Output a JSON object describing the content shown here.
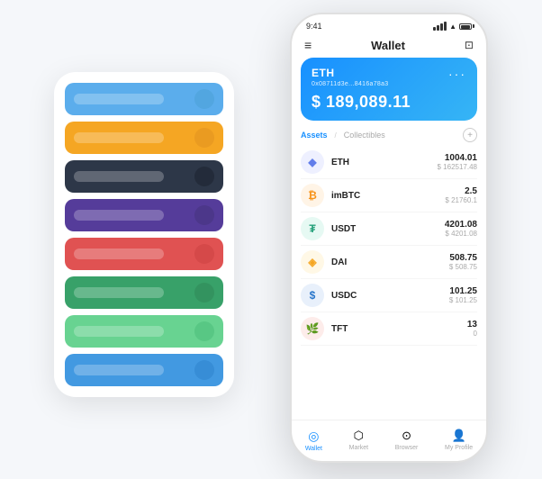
{
  "leftCards": [
    {
      "color": "#5badec",
      "dotColor": "#4a9fd4",
      "id": "blue-light"
    },
    {
      "color": "#f5a623",
      "dotColor": "#e09020",
      "id": "orange"
    },
    {
      "color": "#2d3748",
      "dotColor": "#1a202c",
      "id": "dark"
    },
    {
      "color": "#553c9a",
      "dotColor": "#44317a",
      "id": "purple"
    },
    {
      "color": "#e05252",
      "dotColor": "#c94040",
      "id": "red"
    },
    {
      "color": "#38a169",
      "dotColor": "#2e8655",
      "id": "green"
    },
    {
      "color": "#68d391",
      "dotColor": "#48bb78",
      "id": "green-light"
    },
    {
      "color": "#4299e1",
      "dotColor": "#2b82cb",
      "id": "blue"
    }
  ],
  "statusBar": {
    "time": "9:41"
  },
  "navBar": {
    "title": "Wallet"
  },
  "ethCard": {
    "label": "ETH",
    "address": "0x08711d3e...8416a78a3",
    "balance": "$ 189,089.11"
  },
  "assets": {
    "activeTab": "Assets",
    "inactiveTab": "Collectibles",
    "items": [
      {
        "name": "ETH",
        "amount": "1004.01",
        "usd": "$ 162517.48",
        "iconColor": "#627eea",
        "iconText": "◆",
        "iconBg": "#eef0ff"
      },
      {
        "name": "imBTC",
        "amount": "2.5",
        "usd": "$ 21760.1",
        "iconColor": "#f7931a",
        "iconText": "₿",
        "iconBg": "#fff4e6"
      },
      {
        "name": "USDT",
        "amount": "4201.08",
        "usd": "$ 4201.08",
        "iconColor": "#26a17b",
        "iconText": "₮",
        "iconBg": "#e6f9f3"
      },
      {
        "name": "DAI",
        "amount": "508.75",
        "usd": "$ 508.75",
        "iconColor": "#f5a623",
        "iconText": "◈",
        "iconBg": "#fff8e6"
      },
      {
        "name": "USDC",
        "amount": "101.25",
        "usd": "$ 101.25",
        "iconColor": "#2775ca",
        "iconText": "$",
        "iconBg": "#e8f0fb"
      },
      {
        "name": "TFT",
        "amount": "13",
        "usd": "0",
        "iconColor": "#e05252",
        "iconText": "🌿",
        "iconBg": "#fdecea"
      }
    ]
  },
  "bottomNav": {
    "items": [
      {
        "label": "Wallet",
        "icon": "◎",
        "active": true
      },
      {
        "label": "Market",
        "icon": "📊",
        "active": false
      },
      {
        "label": "Browser",
        "icon": "👤",
        "active": false
      },
      {
        "label": "My Profile",
        "icon": "👤",
        "active": false
      }
    ]
  }
}
